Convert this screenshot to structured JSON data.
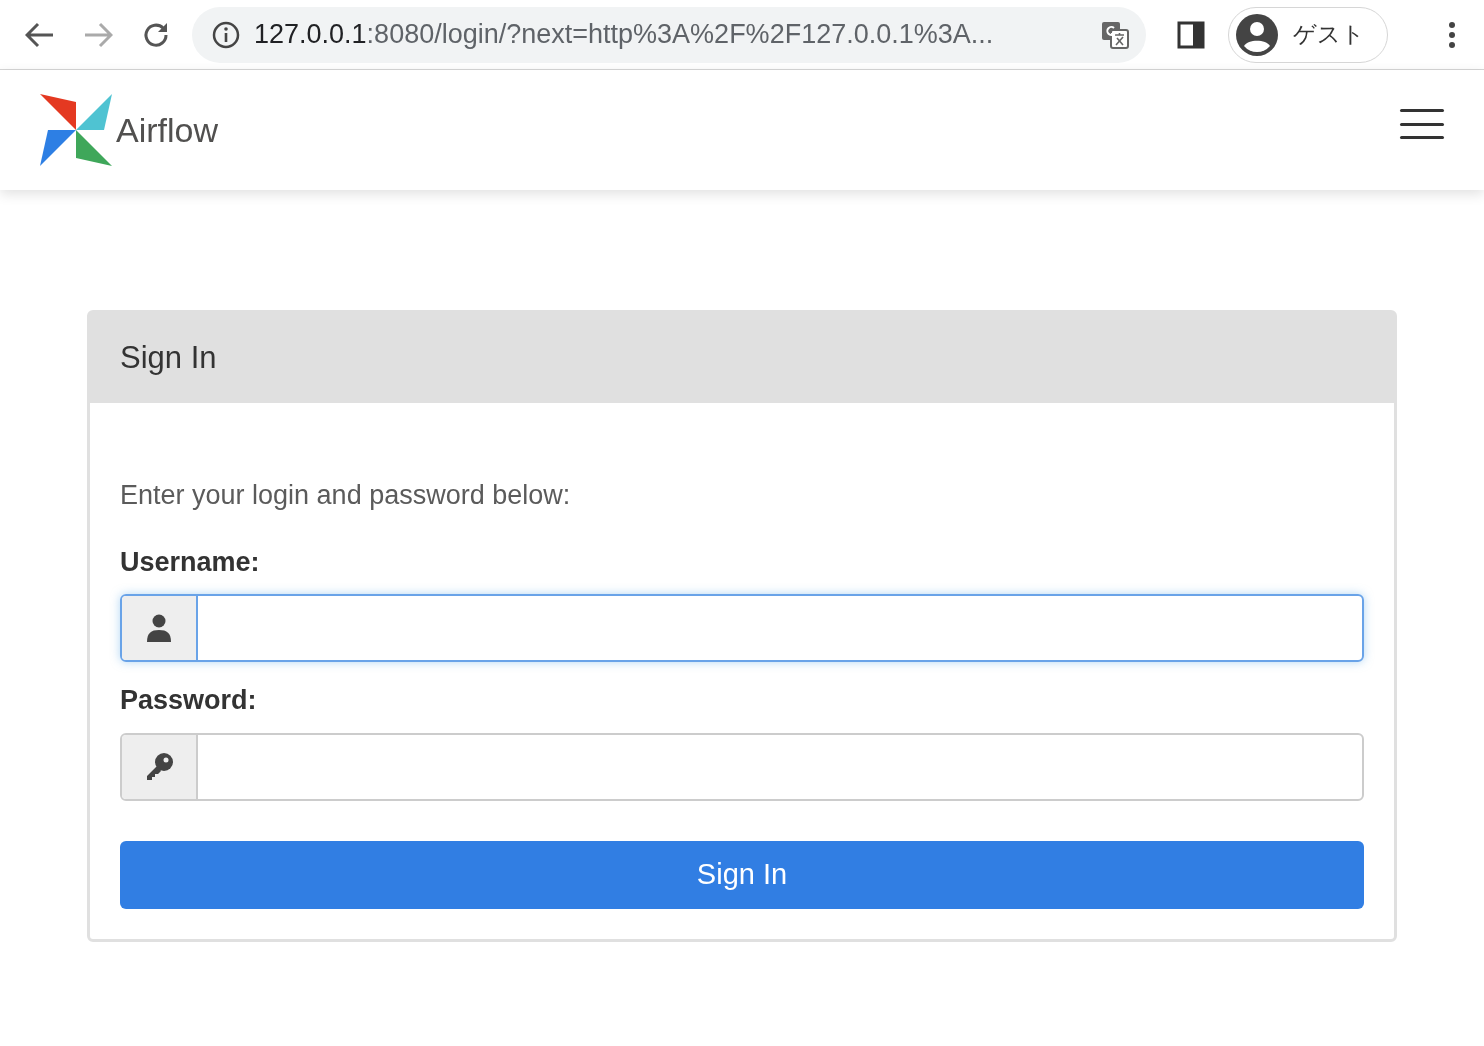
{
  "browser": {
    "url_host": "127.0.0.1",
    "url_rest": ":8080/login/?next=http%3A%2F%2F127.0.0.1%3A...",
    "profile": "ゲスト",
    "forward_disabled": true
  },
  "navbar": {
    "brand": "Airflow"
  },
  "login_card": {
    "title": "Sign In",
    "instructions": "Enter your login and password below:",
    "fields": [
      {
        "kind": "text",
        "label": "Username:",
        "focused": true
      },
      {
        "kind": "password",
        "label": "Password:",
        "focused": false
      }
    ],
    "submit": "Sign In"
  }
}
